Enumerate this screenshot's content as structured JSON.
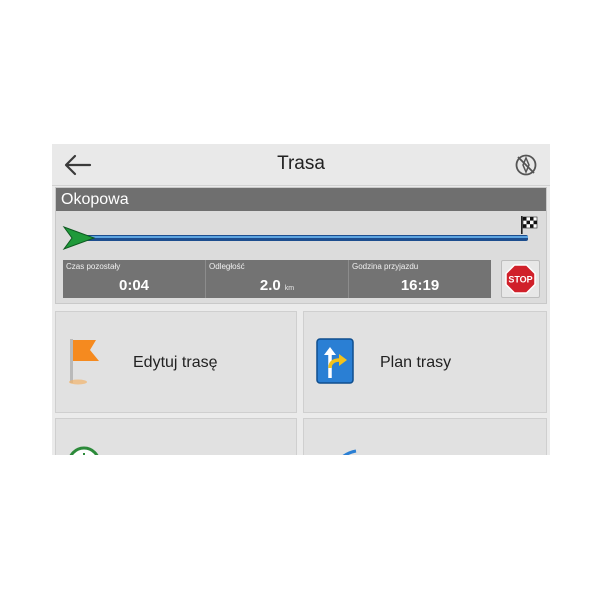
{
  "header": {
    "title": "Trasa",
    "back_icon": "arrow-left-icon",
    "compass_icon": "compass-off-icon"
  },
  "route": {
    "street": "Okopowa",
    "stats": {
      "time_left": {
        "label": "Czas pozostały",
        "value": "0:04"
      },
      "distance": {
        "label": "Odległość",
        "value": "2.0",
        "unit": "km"
      },
      "arrival": {
        "label": "Godzina przyjazdu",
        "value": "16:19"
      }
    },
    "stop_label": "STOP"
  },
  "tiles": [
    {
      "label": "Edytuj trasę",
      "icon": "orange-flag-icon"
    },
    {
      "label": "Plan trasy",
      "icon": "route-plan-icon"
    },
    {
      "label": "",
      "icon": "clock-icon"
    },
    {
      "label": "",
      "icon": "route-settings-icon"
    }
  ],
  "colors": {
    "progress": "#1c4d8e",
    "start_arrow": "#1f9a3a",
    "stop": "#d0202a",
    "flag": "#f58a1f",
    "plan_icon": "#2a7fd4"
  }
}
